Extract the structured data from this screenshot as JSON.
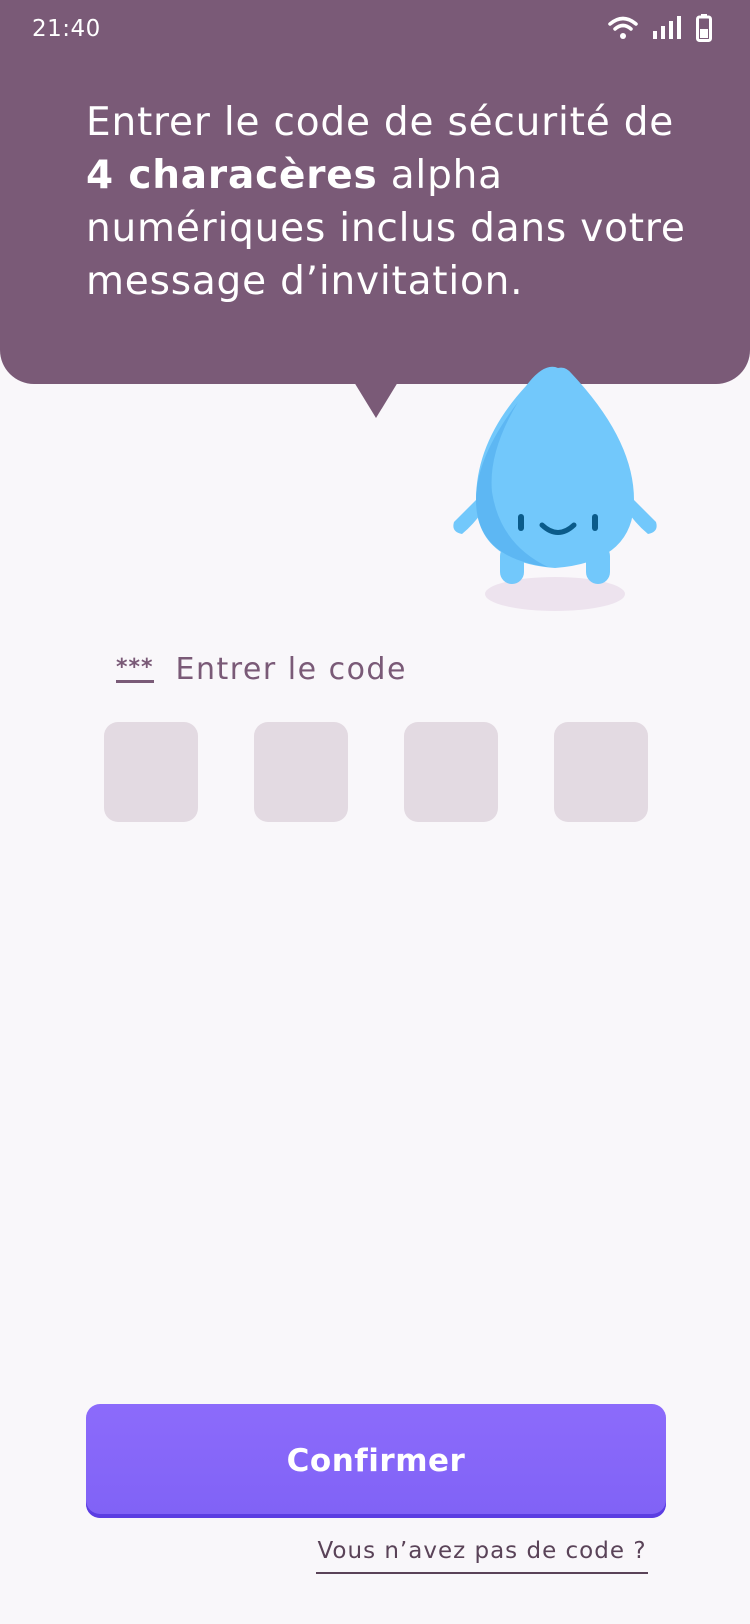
{
  "status_bar": {
    "time": "21:40"
  },
  "instructions": {
    "part1": "Entrer le code de sécurité de ",
    "bold": "4 characères",
    "part2": " alpha numériques inclus dans votre message d’invitation."
  },
  "code_input": {
    "icon_text": "***",
    "label": "Entrer le code",
    "values": [
      "",
      "",
      "",
      ""
    ]
  },
  "confirm_button": {
    "label": "Confirmer"
  },
  "no_code_link": {
    "label": "Vous n’avez pas de code ?"
  },
  "colors": {
    "header": "#7A5A77",
    "background": "#F9F7FA",
    "code_box": "#E3DAE2",
    "button": "#8062F6",
    "mascot": "#72C8FB"
  },
  "icons": [
    "wifi-icon",
    "signal-icon",
    "battery-icon",
    "password-icon",
    "water-drop-mascot"
  ]
}
